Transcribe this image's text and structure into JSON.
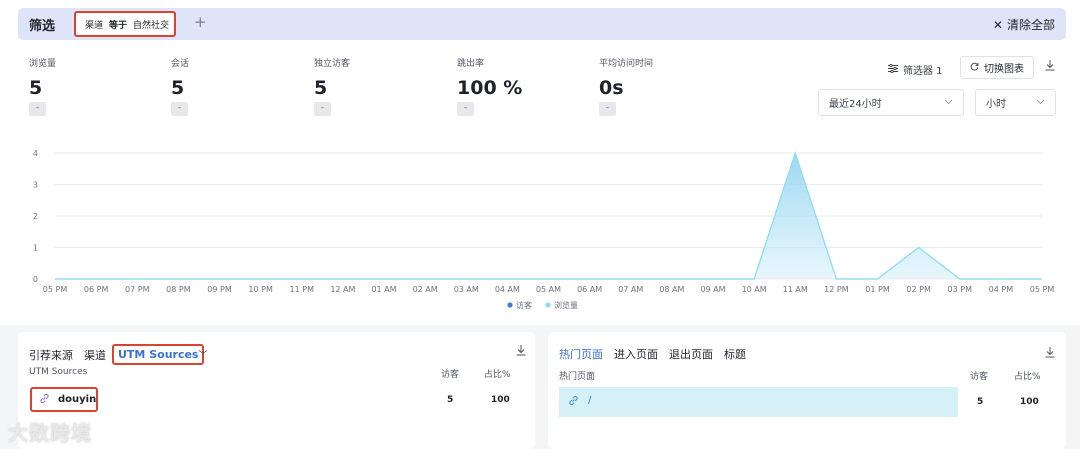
{
  "filter": {
    "title": "筛选",
    "chip": {
      "field": "渠道",
      "op": "等于",
      "value": "自然社交",
      "remove": "×"
    },
    "add": "+",
    "clear_icon": "✕",
    "clear_all": "清除全部"
  },
  "metrics": [
    {
      "label": "浏览量",
      "value": "5",
      "change": "-"
    },
    {
      "label": "会话",
      "value": "5",
      "change": "-"
    },
    {
      "label": "独立访客",
      "value": "5",
      "change": "-"
    },
    {
      "label": "跳出率",
      "value": "100 %",
      "change": "-"
    },
    {
      "label": "平均访问时间",
      "value": "0s",
      "change": "-"
    }
  ],
  "controls": {
    "filters_icon": "filter-lines-icon",
    "filters_label": "筛选器 1",
    "switch_icon": "refresh-icon",
    "switch_label": "切换图表",
    "range_select": "最近24小时",
    "interval_select": "小时"
  },
  "chart_data": {
    "type": "area",
    "x": [
      "05 PM",
      "06 PM",
      "07 PM",
      "08 PM",
      "09 PM",
      "10 PM",
      "11 PM",
      "12 AM",
      "01 AM",
      "02 AM",
      "03 AM",
      "04 AM",
      "05 AM",
      "06 AM",
      "07 AM",
      "08 AM",
      "09 AM",
      "10 AM",
      "11 AM",
      "12 PM",
      "01 PM",
      "02 PM",
      "03 PM",
      "04 PM",
      "05 PM"
    ],
    "series": [
      {
        "name": "访客",
        "color": "#3b7fd4",
        "values": [
          0,
          0,
          0,
          0,
          0,
          0,
          0,
          0,
          0,
          0,
          0,
          0,
          0,
          0,
          0,
          0,
          0,
          0,
          4,
          0,
          0,
          1,
          0,
          0,
          0
        ]
      },
      {
        "name": "浏览量",
        "color": "#8fdcf2",
        "values": [
          0,
          0,
          0,
          0,
          0,
          0,
          0,
          0,
          0,
          0,
          0,
          0,
          0,
          0,
          0,
          0,
          0,
          0,
          4,
          0,
          0,
          1,
          0,
          0,
          0
        ]
      }
    ],
    "yticks": [
      "0",
      "1",
      "2",
      "3",
      "4"
    ],
    "ylim": [
      0,
      4
    ],
    "grid": true,
    "legend": "bottom"
  },
  "sources": {
    "tabs": [
      "引荐来源",
      "渠道",
      "UTM Sources"
    ],
    "chevron": "﹀",
    "col_name": "UTM Sources",
    "col_visitors": "访客",
    "col_pct": "占比%",
    "rows": [
      {
        "name": "douyin",
        "visitors": "5",
        "pct": "100"
      }
    ]
  },
  "pages": {
    "tabs": [
      "热门页面",
      "进入页面",
      "退出页面",
      "标题"
    ],
    "col_name": "热门页面",
    "col_visitors": "访客",
    "col_pct": "占比%",
    "rows": [
      {
        "name": "/",
        "visitors": "5",
        "pct": "100"
      }
    ]
  },
  "watermark": "大数跨境"
}
